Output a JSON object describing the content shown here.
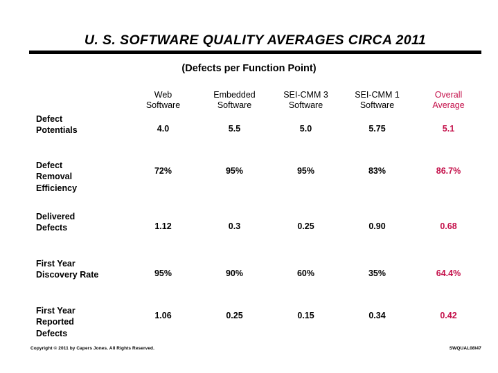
{
  "slide": {
    "title": "U. S. SOFTWARE QUALITY AVERAGES CIRCA 2011",
    "subtitle": "(Defects per Function Point)",
    "accent_color": "#C4104A"
  },
  "table": {
    "row_header_label": "",
    "columns": [
      "Web Software",
      "Embedded Software",
      "SEI-CMM 3 Software",
      "SEI-CMM 1 Software",
      "Overall Average"
    ],
    "columns_lines": [
      {
        "line1": "Web",
        "line2": "Software"
      },
      {
        "line1": "Embedded",
        "line2": "Software"
      },
      {
        "line1": "SEI-CMM 3",
        "line2": "Software"
      },
      {
        "line1": "SEI-CMM 1",
        "line2": "Software"
      },
      {
        "line1": "Overall",
        "line2": "Average"
      }
    ],
    "rows": [
      {
        "label_lines": [
          "Defect",
          "Potentials"
        ],
        "label": "Defect Potentials",
        "values": [
          "4.0",
          "5.5",
          "5.0",
          "5.75"
        ],
        "overall": "5.1"
      },
      {
        "label_lines": [
          "Defect",
          "Removal",
          "Efficiency"
        ],
        "label": "Defect Removal Efficiency",
        "values": [
          "72%",
          "95%",
          "95%",
          "83%"
        ],
        "overall": "86.7%"
      },
      {
        "label_lines": [
          "Delivered",
          "Defects"
        ],
        "label": "Delivered Defects",
        "values": [
          "1.12",
          "0.3",
          "0.25",
          "0.90"
        ],
        "overall": "0.68"
      },
      {
        "label_lines": [
          "First Year",
          "Discovery Rate"
        ],
        "label": "First Year Discovery Rate",
        "values": [
          "95%",
          "90%",
          "60%",
          "35%"
        ],
        "overall": "64.4%"
      },
      {
        "label_lines": [
          "First Year",
          "Reported",
          "Defects"
        ],
        "label": "First Year Reported Defects",
        "values": [
          "1.06",
          "0.25",
          "0.15",
          "0.34"
        ],
        "overall": "0.42"
      }
    ]
  },
  "footer": {
    "copyright": "Copyright © 2011 by Capers Jones. All Rights Reserved.",
    "code": "SWQUAL08\\47"
  },
  "chart_data": {
    "type": "table",
    "title": "U. S. SOFTWARE QUALITY AVERAGES CIRCA 2011",
    "subtitle": "(Defects per Function Point)",
    "categories": [
      "Web Software",
      "Embedded Software",
      "SEI-CMM 3 Software",
      "SEI-CMM 1 Software",
      "Overall Average"
    ],
    "series": [
      {
        "name": "Defect Potentials",
        "values": [
          4.0,
          5.5,
          5.0,
          5.75,
          5.1
        ]
      },
      {
        "name": "Defect Removal Efficiency",
        "values": [
          "72%",
          "95%",
          "95%",
          "83%",
          "86.7%"
        ]
      },
      {
        "name": "Delivered Defects",
        "values": [
          1.12,
          0.3,
          0.25,
          0.9,
          0.68
        ]
      },
      {
        "name": "First Year Discovery Rate",
        "values": [
          "95%",
          "90%",
          "60%",
          "35%",
          "64.4%"
        ]
      },
      {
        "name": "First Year Reported Defects",
        "values": [
          1.06,
          0.25,
          0.15,
          0.34,
          0.42
        ]
      }
    ],
    "xlabel": "",
    "ylabel": "",
    "grid": false,
    "legend": "none"
  }
}
